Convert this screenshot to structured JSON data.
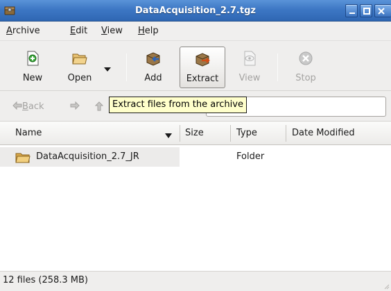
{
  "window": {
    "title": "DataAcquisition_2.7.tgz"
  },
  "menu": {
    "archive": {
      "label": "Archive",
      "accel": "A",
      "rest": "rchive"
    },
    "edit": {
      "label": "Edit",
      "accel": "E",
      "rest": "dit"
    },
    "view": {
      "label": "View",
      "accel": "V",
      "rest": "iew"
    },
    "help": {
      "label": "Help",
      "accel": "H",
      "rest": "elp"
    }
  },
  "toolbar": {
    "new_label": "New",
    "open_label": "Open",
    "add_label": "Add",
    "extract_label": "Extract",
    "view_label": "View",
    "stop_label": "Stop"
  },
  "location": {
    "back_accel": "B",
    "back_rest": "ack",
    "input_value": ""
  },
  "tooltip": {
    "text": "Extract files from the archive"
  },
  "columns": {
    "name": "Name",
    "size": "Size",
    "type": "Type",
    "date_modified": "Date Modified"
  },
  "files": [
    {
      "name": "DataAcquisition_2.7_JR",
      "size": "",
      "type": "Folder",
      "date_modified": ""
    }
  ],
  "status": {
    "text": "12 files (258.3 MB)"
  },
  "colors": {
    "titlebar": "#3d77c4",
    "tooltip_bg": "#ffffcb",
    "selected_cell": "#ecebea"
  }
}
